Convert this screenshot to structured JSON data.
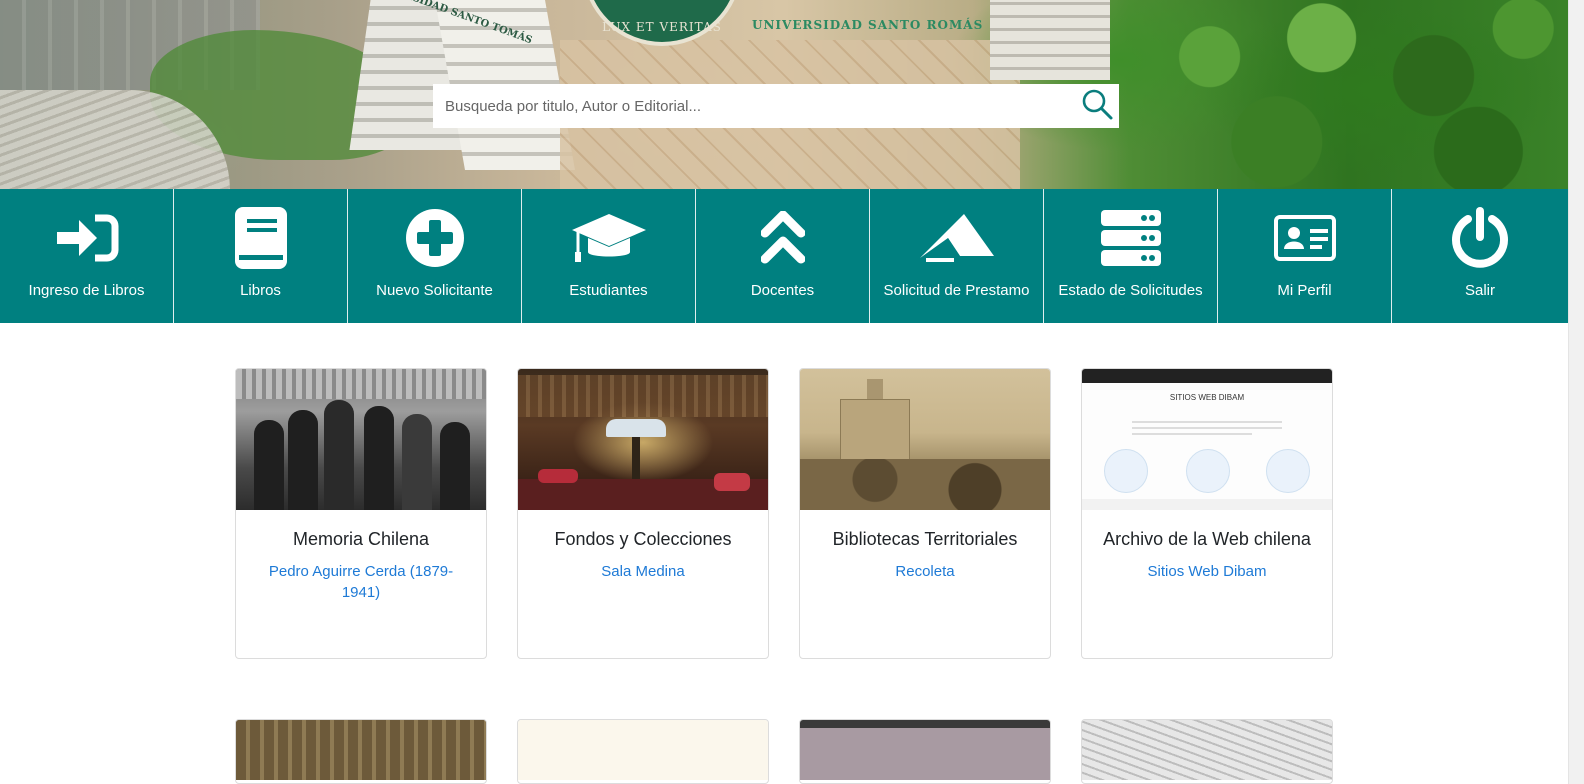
{
  "hero": {
    "institution_name": "UNIVERSIDAD SANTO ROMÁS",
    "motto": "LUX ET VERITAS",
    "tower_text": "UNIVERSIDAD SANTO TOMÁS"
  },
  "search": {
    "placeholder": "Busqueda por titulo, Autor o Editorial...",
    "value": "",
    "icon": "search-icon"
  },
  "nav": {
    "color": "#008080",
    "items": [
      {
        "label": "Ingreso de Libros",
        "icon": "sign-in-icon"
      },
      {
        "label": "Libros",
        "icon": "book-icon"
      },
      {
        "label": "Nuevo Solicitante",
        "icon": "plus-circle-icon"
      },
      {
        "label": "Estudiantes",
        "icon": "graduation-cap-icon"
      },
      {
        "label": "Docentes",
        "icon": "double-chevron-up-icon"
      },
      {
        "label": "Solicitud de Prestamo",
        "icon": "paper-plane-icon"
      },
      {
        "label": "Estado de Solicitudes",
        "icon": "server-icon"
      },
      {
        "label": "Mi Perfil",
        "icon": "id-card-icon"
      },
      {
        "label": "Salir",
        "icon": "power-icon"
      }
    ]
  },
  "cards": [
    {
      "title": "Memoria Chilena",
      "link": "Pedro Aguirre Cerda (1879-1941)"
    },
    {
      "title": "Fondos y Colecciones",
      "link": "Sala Medina"
    },
    {
      "title": "Bibliotecas Territoriales",
      "link": "Recoleta"
    },
    {
      "title": "Archivo de la Web chilena",
      "link": "Sitios Web Dibam",
      "image_heading": "SITIOS WEB DIBAM"
    }
  ],
  "colors": {
    "accent": "#008080",
    "link": "#1e7ad6",
    "title": "#212529"
  }
}
